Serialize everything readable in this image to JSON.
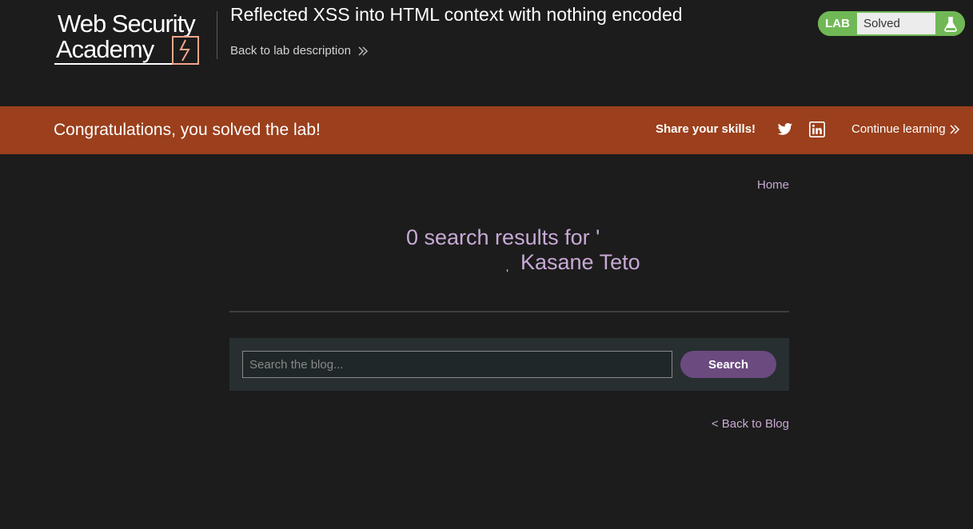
{
  "header": {
    "logo_line1": "Web Security",
    "logo_line2": "Academy",
    "lab_title": "Reflected XSS into HTML context with nothing encoded",
    "back_link": "Back to lab description",
    "status": {
      "tag": "LAB",
      "state": "Solved",
      "icon": "flask-icon"
    }
  },
  "banner": {
    "message": "Congratulations, you solved the lab!",
    "share_label": "Share your skills!",
    "icons": [
      "twitter-icon",
      "linkedin-icon"
    ],
    "continue_label": "Continue learning"
  },
  "content": {
    "home_link": "Home",
    "results_line1": "0 search results for '",
    "results_name": "Kasane Teto",
    "results_close_quote": "'",
    "search_placeholder": "Search the blog...",
    "search_button": "Search",
    "back_to_blog": "< Back to Blog"
  },
  "colors": {
    "banner": "#9b3f1c",
    "accent": "#c7a9d5",
    "status_green": "#70b855",
    "button": "#6b4a7f"
  }
}
